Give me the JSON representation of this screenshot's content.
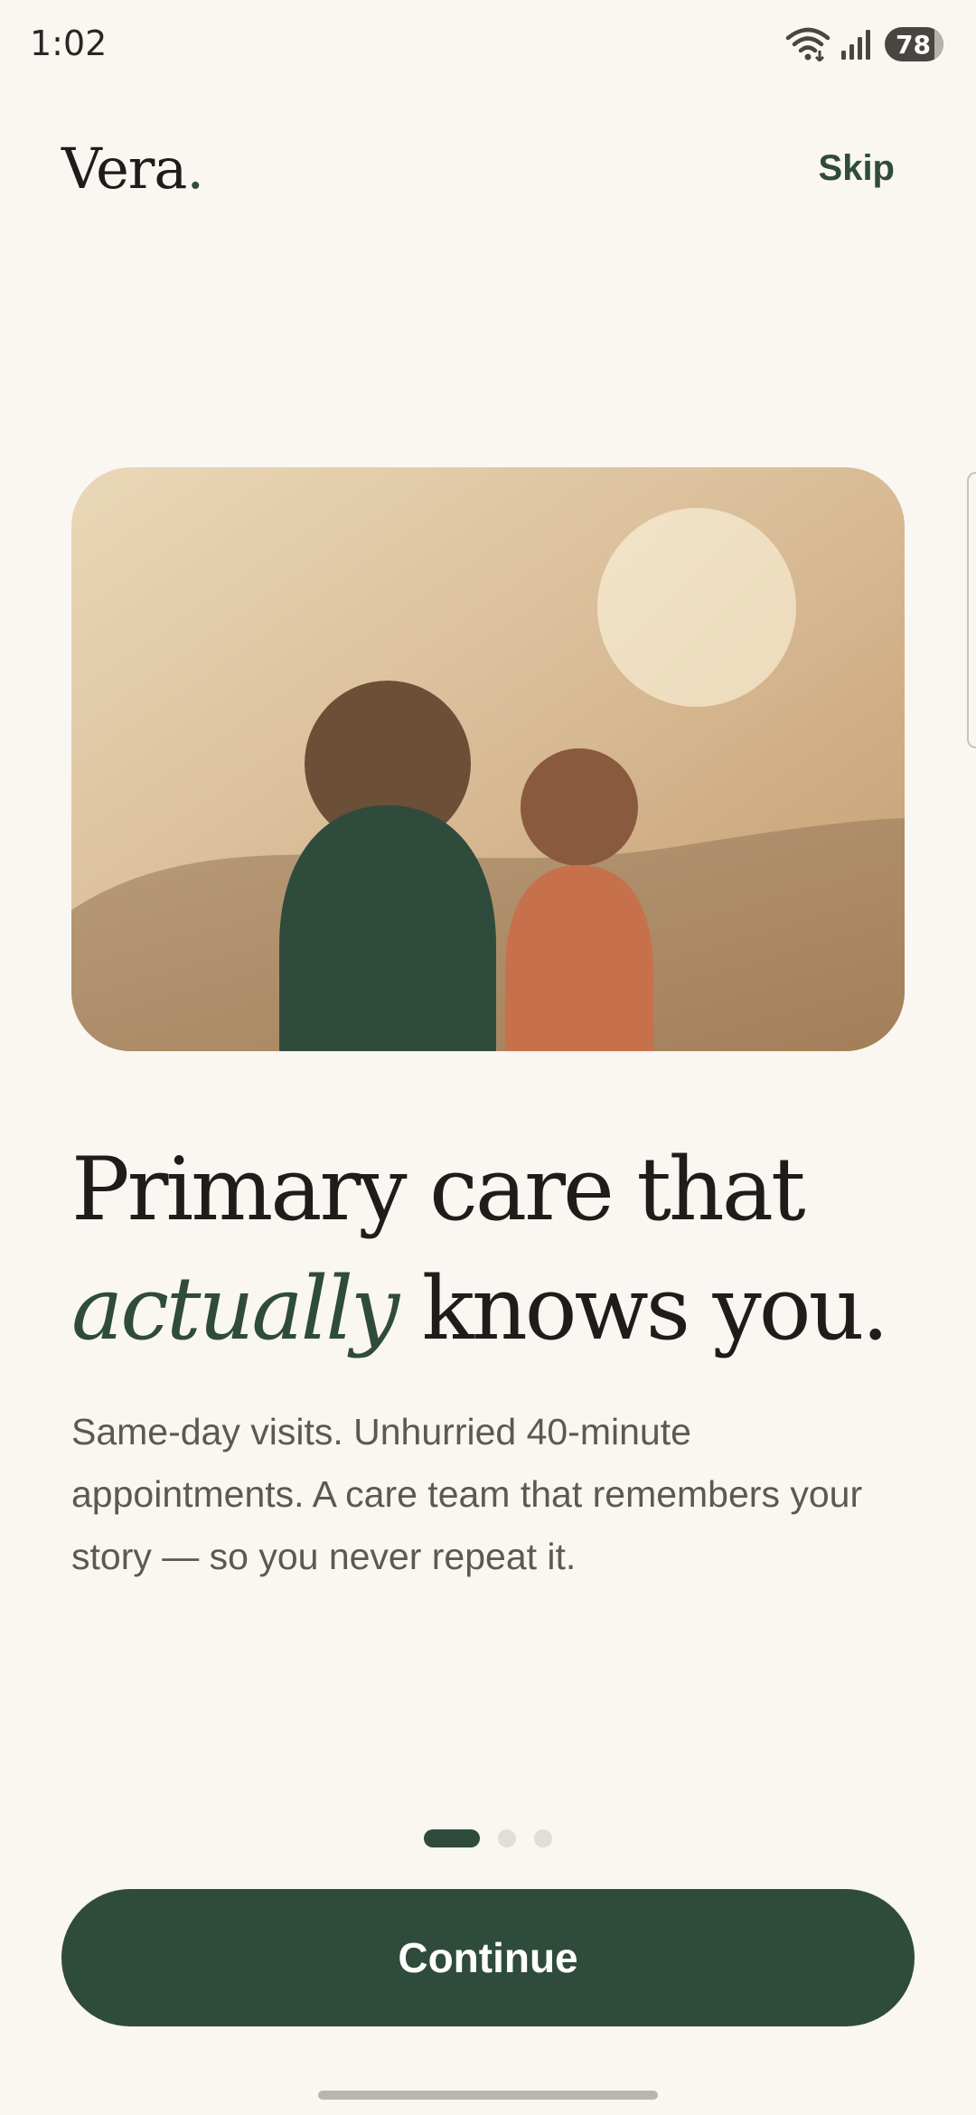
{
  "status_bar": {
    "time": "1:02",
    "battery": "78",
    "icons": [
      "wifi-icon",
      "signal-icon",
      "battery-icon"
    ]
  },
  "header": {
    "logo_text": "Vera",
    "logo_dot": ".",
    "skip_label": "Skip"
  },
  "hero": {
    "illustration": "two-figures-watching-sun-illustration"
  },
  "headline": {
    "line1": "Primary care that",
    "emphasis": "actually",
    "line2_rest": " knows you."
  },
  "subtitle": "Same-day visits. Unhurried 40-minute appointments. A care team that remembers your story — so you never repeat it.",
  "pager": {
    "count": 3,
    "active_index": 0
  },
  "cta": {
    "continue_label": "Continue"
  },
  "colors": {
    "background": "#faf6f1",
    "brand_green": "#2f4b3c",
    "terracotta": "#c6714b",
    "text_primary": "#1f1c19",
    "text_secondary": "#5d5852"
  }
}
